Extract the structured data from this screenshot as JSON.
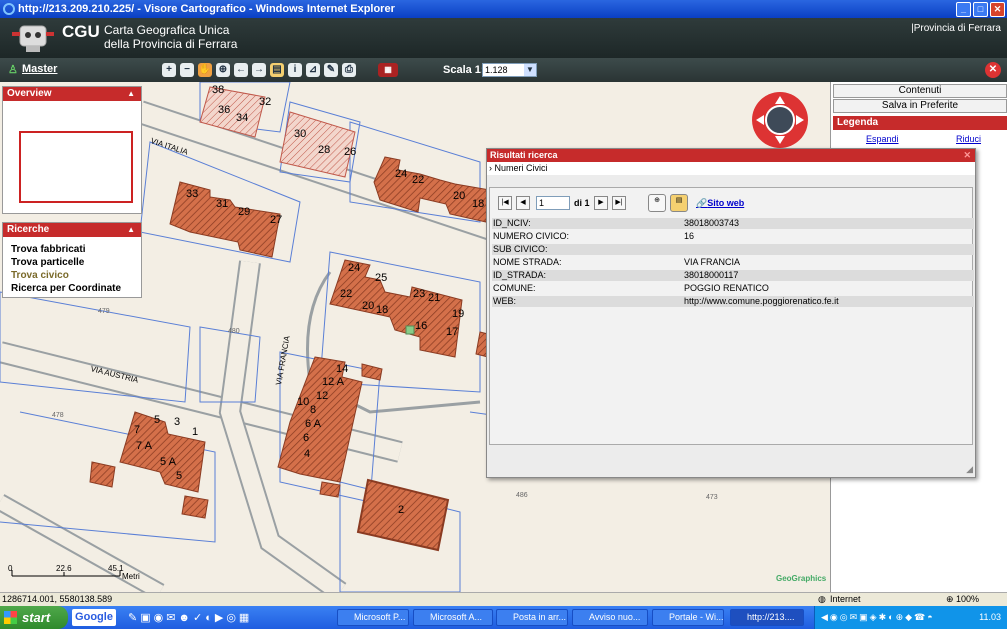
{
  "window": {
    "title": "http://213.209.210.225/ - Visore Cartografico - Windows Internet Explorer"
  },
  "header": {
    "logo": "CGU",
    "subtitle_line1": "Carta Geografica Unica",
    "subtitle_line2": "della Provincia di Ferrara",
    "province_link": "|Provincia di Ferrara"
  },
  "toolbar": {
    "master": "Master",
    "scala_label": "Scala 1:",
    "scala_value": "1.128"
  },
  "right_panel": {
    "contenuti": "Contenuti",
    "salva": "Salva in Preferite",
    "legenda": "Legenda",
    "espandi": "Espandi",
    "riduci": "Riduci"
  },
  "overview": {
    "title": "Overview"
  },
  "ricerche": {
    "title": "Ricerche",
    "items": [
      "Trova fabbricati",
      "Trova particelle",
      "Trova civico",
      "Ricerca per Coordinate"
    ]
  },
  "dialog": {
    "title": "Risultati ricerca",
    "tree_node": "Numeri Civici",
    "page": "1",
    "of_pages": "di 1",
    "sito_web": "Sito web",
    "fields": [
      {
        "k": "ID_NCIV:",
        "v": "38018003743"
      },
      {
        "k": "NUMERO CIVICO:",
        "v": "16"
      },
      {
        "k": "SUB CIVICO:",
        "v": ""
      },
      {
        "k": "NOME STRADA:",
        "v": "VIA FRANCIA"
      },
      {
        "k": "ID_STRADA:",
        "v": "38018000117"
      },
      {
        "k": "COMUNE:",
        "v": "POGGIO RENATICO"
      },
      {
        "k": "WEB:",
        "v": "http://www.comune.poggiorenatico.fe.it"
      }
    ]
  },
  "map": {
    "streets": [
      "VIA ITALIA",
      "VIA FRANCIA",
      "VIA AUSTRIA"
    ],
    "parcels": [
      "479",
      "480",
      "478",
      "486",
      "473"
    ],
    "house_numbers": [
      "38",
      "36",
      "34",
      "32",
      "30",
      "28",
      "26",
      "24",
      "22",
      "20",
      "18",
      "33",
      "31",
      "29",
      "27",
      "24",
      "25",
      "22",
      "20",
      "18",
      "23",
      "21",
      "19",
      "17",
      "16",
      "14",
      "12 A",
      "12",
      "10",
      "8",
      "6 A",
      "6",
      "4",
      "7",
      "7 A",
      "5",
      "3",
      "1",
      "5 A",
      "5",
      "2"
    ],
    "scale_ticks": [
      "0",
      "22.6",
      "45.1"
    ],
    "scale_unit": "Metri",
    "credit": "GeoGraphics"
  },
  "status": {
    "coords": "1286714.001, 5580138.589",
    "zone": "Internet",
    "zoom": "100%"
  },
  "taskbar": {
    "start": "start",
    "google": "Google",
    "tasks": [
      "Microsoft P...",
      "Microsoft A...",
      "Posta in arr...",
      "Avviso nuo...",
      "Portale - Wi...",
      "http://213...."
    ],
    "clock": "11.03"
  },
  "colors": {
    "accent_red": "#c62b2b",
    "building": "#d4704a",
    "parcel_line": "#5a7fd6",
    "road": "#9aa0a3"
  }
}
